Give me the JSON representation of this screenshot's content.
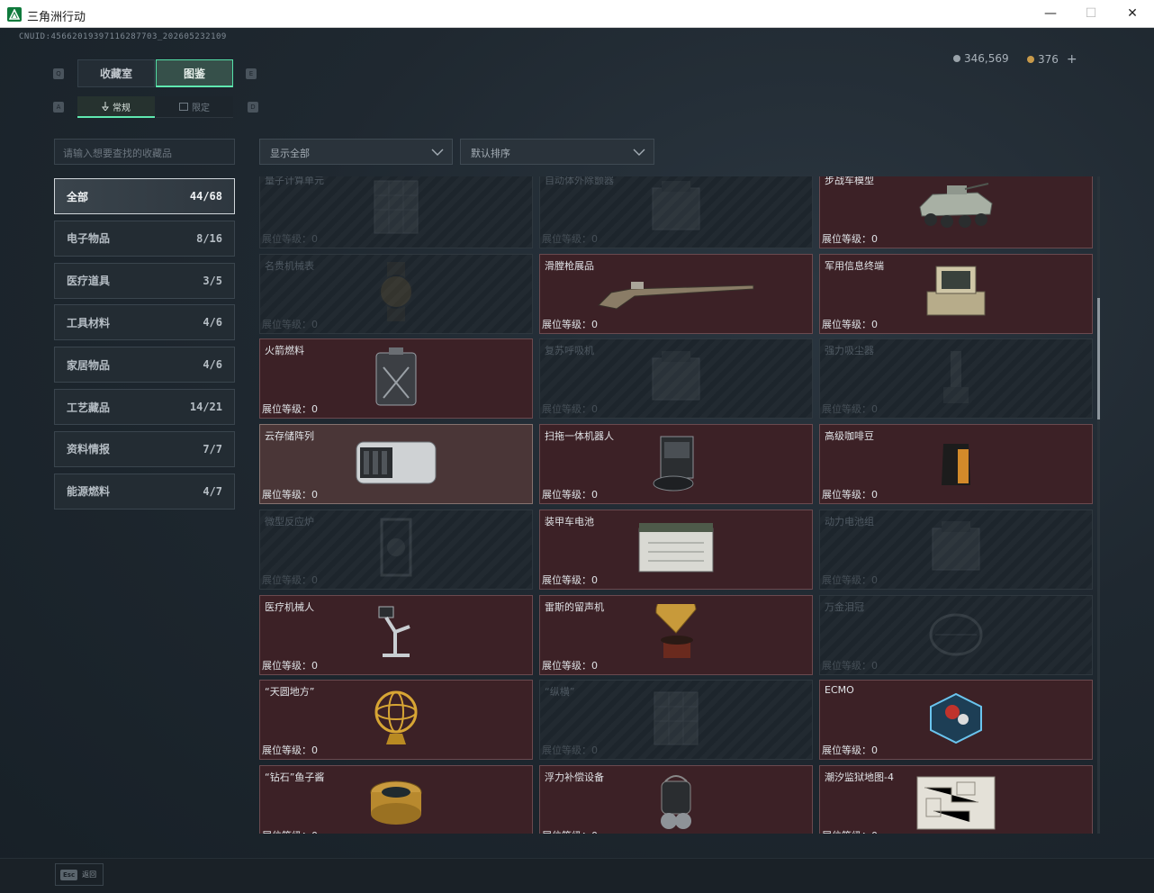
{
  "window": {
    "title": "三角洲行动",
    "minimize": "—",
    "maximize": "☐",
    "close": "✕"
  },
  "uid": "CNUID:45662019397116287703_202605232109",
  "currency": {
    "coins": "346,569",
    "tickets": "376",
    "add": "+"
  },
  "keys": {
    "q": "Q",
    "e": "E",
    "a": "A",
    "d": "D"
  },
  "tabs": {
    "collection": "收藏室",
    "codex": "图鉴",
    "regular": "常规",
    "limited": "限定"
  },
  "search": {
    "placeholder": "请输入想要查找的收藏品"
  },
  "filters": {
    "show": "显示全部",
    "sort": "默认排序"
  },
  "categories": [
    {
      "label": "全部",
      "count": "44/68"
    },
    {
      "label": "电子物品",
      "count": "8/16"
    },
    {
      "label": "医疗道具",
      "count": "3/5"
    },
    {
      "label": "工具材料",
      "count": "4/6"
    },
    {
      "label": "家居物品",
      "count": "4/6"
    },
    {
      "label": "工艺藏品",
      "count": "14/21"
    },
    {
      "label": "资料情报",
      "count": "7/7"
    },
    {
      "label": "能源燃料",
      "count": "4/7"
    }
  ],
  "level_label": "展位等级：0",
  "items": [
    {
      "name": "量子计算单元",
      "art": "board"
    },
    {
      "name": "自动体外除颤器",
      "art": "box"
    },
    {
      "name": "步战车模型",
      "art": "tank"
    },
    {
      "name": "名贵机械表",
      "art": "watch"
    },
    {
      "name": "滑膛枪展品",
      "art": "musket"
    },
    {
      "name": "军用信息终端",
      "art": "terminal"
    },
    {
      "name": "火箭燃料",
      "art": "jerrycan"
    },
    {
      "name": "复苏呼吸机",
      "art": "box"
    },
    {
      "name": "强力吸尘器",
      "art": "vacuum"
    },
    {
      "name": "云存储阵列",
      "art": "server"
    },
    {
      "name": "扫拖一体机器人",
      "art": "robot"
    },
    {
      "name": "高级咖啡豆",
      "art": "coffee"
    },
    {
      "name": "微型反应炉",
      "art": "reactor"
    },
    {
      "name": "装甲车电池",
      "art": "battery"
    },
    {
      "name": "动力电池组",
      "art": "box"
    },
    {
      "name": "医疗机械人",
      "art": "medbot"
    },
    {
      "name": "雷斯的留声机",
      "art": "gramophone"
    },
    {
      "name": "万金泪冠",
      "art": "crown"
    },
    {
      "name": "“天圆地方”",
      "art": "armillary"
    },
    {
      "name": "“纵横”",
      "art": "board"
    },
    {
      "name": "ECMO",
      "art": "ecmo"
    },
    {
      "name": "“钻石”鱼子酱",
      "art": "caviar"
    },
    {
      "name": "浮力补偿设备",
      "art": "diving"
    },
    {
      "name": "潮汐监狱地图-4",
      "art": "map"
    }
  ],
  "collected": [
    false,
    false,
    true,
    false,
    true,
    true,
    true,
    false,
    false,
    true,
    true,
    true,
    false,
    true,
    false,
    true,
    true,
    false,
    true,
    false,
    true,
    true,
    true,
    true
  ],
  "footer": {
    "esc_key": "Esc",
    "back": "返回"
  }
}
